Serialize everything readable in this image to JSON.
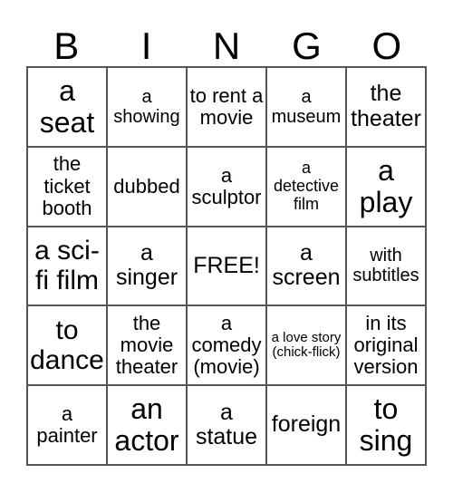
{
  "header": [
    "B",
    "I",
    "N",
    "G",
    "O"
  ],
  "cells": [
    {
      "text": "a seat",
      "size": "s32"
    },
    {
      "text": "a showing",
      "size": "s20"
    },
    {
      "text": "to rent a movie",
      "size": "s22"
    },
    {
      "text": "a museum",
      "size": "s20"
    },
    {
      "text": "the theater",
      "size": "s25"
    },
    {
      "text": "the ticket booth",
      "size": "s22"
    },
    {
      "text": "dubbed",
      "size": "s22"
    },
    {
      "text": "a sculptor",
      "size": "s22"
    },
    {
      "text": "a detective film",
      "size": "s18"
    },
    {
      "text": "a play",
      "size": "s32"
    },
    {
      "text": "a sci-fi film",
      "size": "s30"
    },
    {
      "text": "a singer",
      "size": "s25"
    },
    {
      "text": "FREE!",
      "size": "s25"
    },
    {
      "text": "a screen",
      "size": "s25"
    },
    {
      "text": "with subtitles",
      "size": "s20"
    },
    {
      "text": "to dance",
      "size": "s30"
    },
    {
      "text": "the movie theater",
      "size": "s22"
    },
    {
      "text": "a comedy (movie)",
      "size": "s22"
    },
    {
      "text": "a love story (chick-flick)",
      "size": "s15"
    },
    {
      "text": "in its original version",
      "size": "s22"
    },
    {
      "text": "a painter",
      "size": "s22"
    },
    {
      "text": "an actor",
      "size": "s32"
    },
    {
      "text": "a statue",
      "size": "s25"
    },
    {
      "text": "foreign",
      "size": "s25"
    },
    {
      "text": "to sing",
      "size": "s32"
    }
  ]
}
